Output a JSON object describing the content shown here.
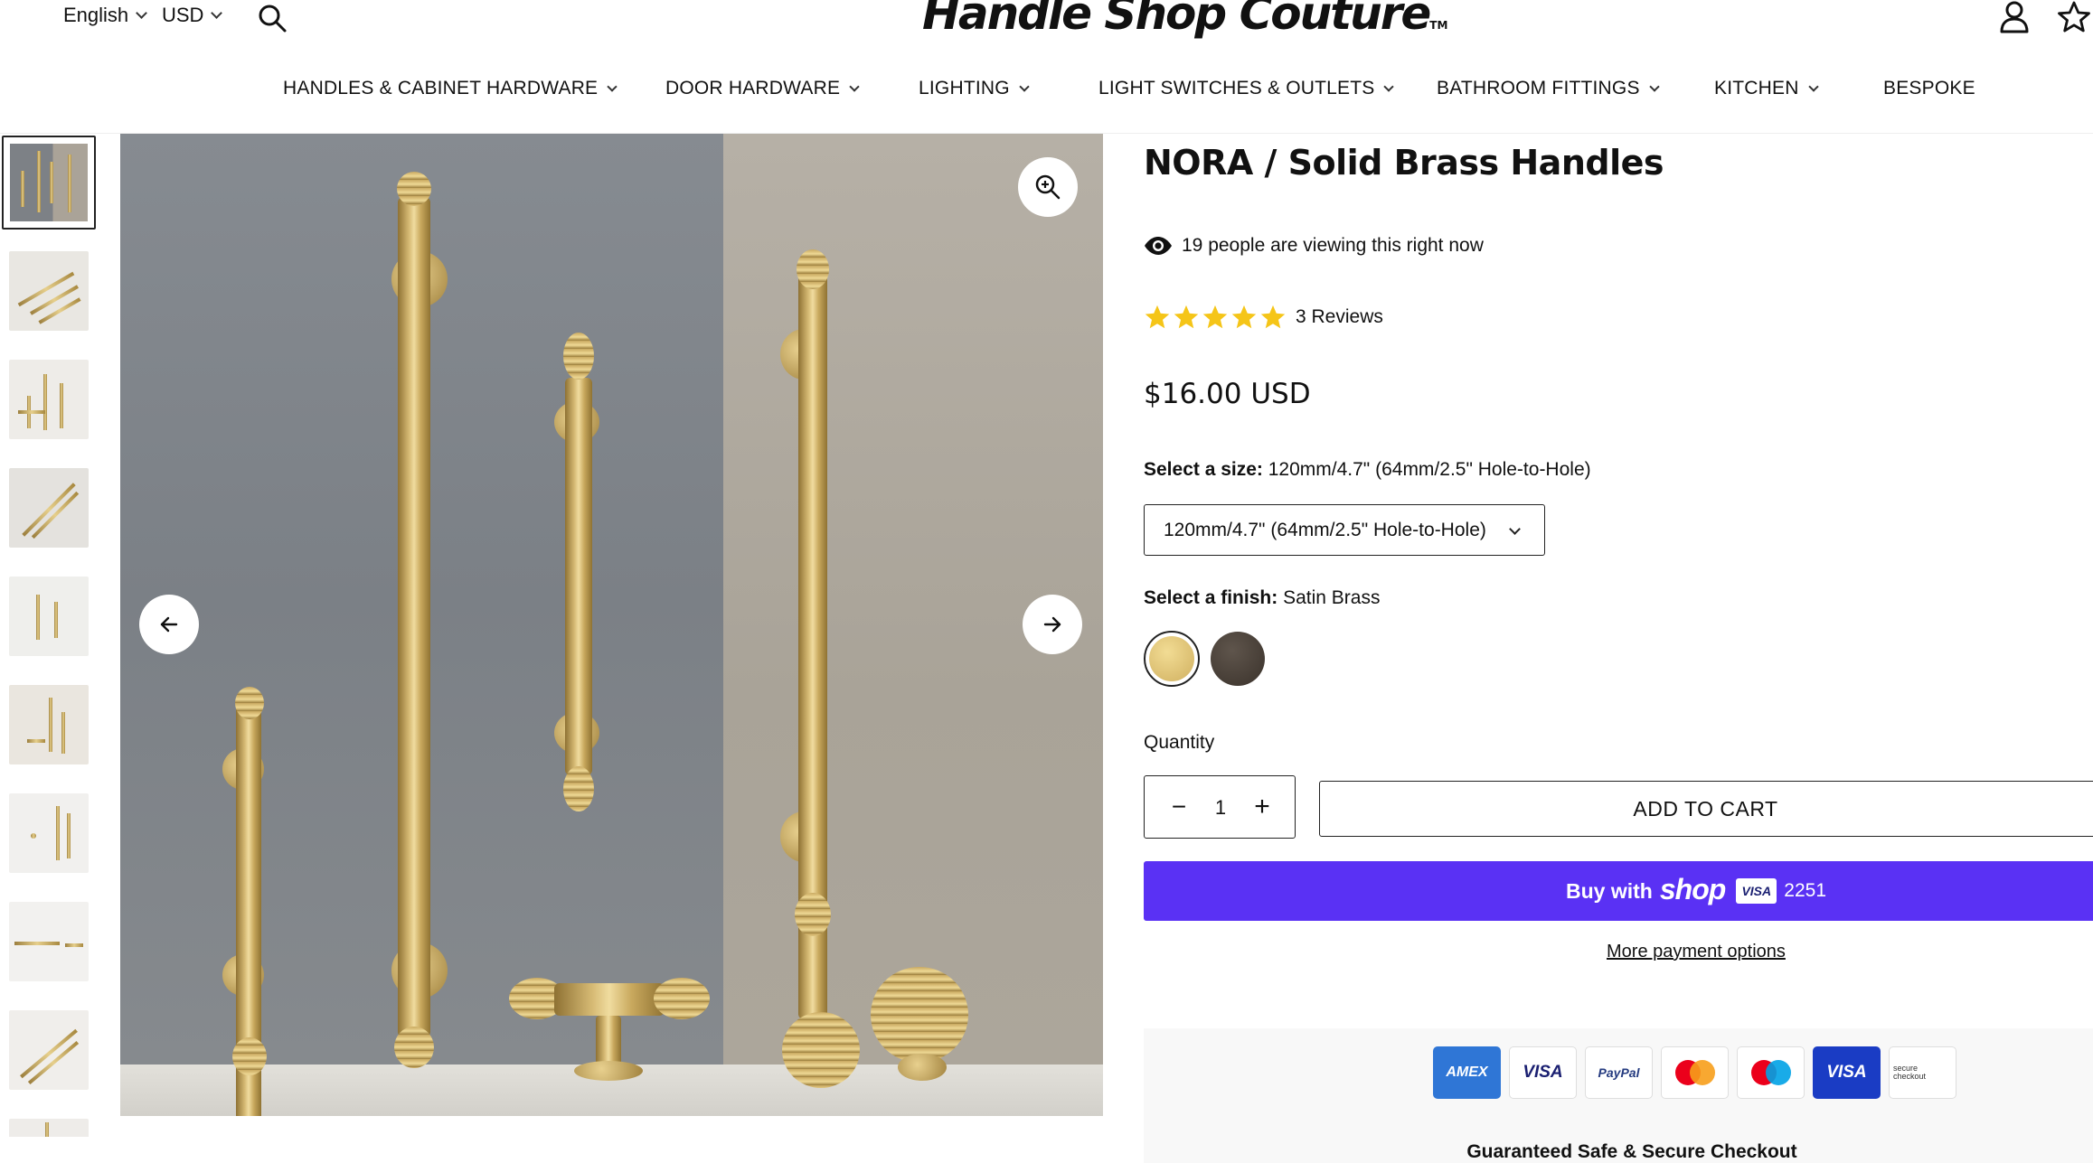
{
  "header": {
    "language": "English",
    "currency": "USD",
    "logo_text": "Handle Shop Couture",
    "logo_tm": "TM"
  },
  "nav": {
    "items": [
      {
        "label": "HANDLES & CABINET HARDWARE",
        "has_dropdown": true
      },
      {
        "label": "DOOR HARDWARE",
        "has_dropdown": true
      },
      {
        "label": "LIGHTING",
        "has_dropdown": true
      },
      {
        "label": "LIGHT SWITCHES & OUTLETS",
        "has_dropdown": true
      },
      {
        "label": "BATHROOM FITTINGS",
        "has_dropdown": true
      },
      {
        "label": "KITCHEN",
        "has_dropdown": true
      },
      {
        "label": "BESPOKE",
        "has_dropdown": false
      }
    ]
  },
  "gallery": {
    "thumbnail_count": 10,
    "active_index": 0
  },
  "product": {
    "title": "NORA / Solid Brass Handles",
    "viewing": "19 people are viewing this right now",
    "rating": 5,
    "reviews": "3 Reviews",
    "price": "$16.00 USD",
    "size_label": "Select a size:",
    "size_value": "120mm/4.7\" (64mm/2.5\" Hole-to-Hole)",
    "size_selected": "120mm/4.7\" (64mm/2.5\" Hole-to-Hole)",
    "finish_label": "Select a finish:",
    "finish_value": "Satin Brass",
    "quantity_label": "Quantity",
    "quantity": "1",
    "qty_minus": "−",
    "qty_plus": "+",
    "add_to_cart": "ADD TO CART",
    "buy_with": "Buy with",
    "shop_brand": "shop",
    "card_brand": "VISA",
    "card_last4": "2251",
    "more_payment": "More payment options"
  },
  "payment": {
    "cards": [
      "AMEX",
      "VISA",
      "PayPal",
      "mastercard",
      "maestro",
      "VISA",
      "secure checkout"
    ],
    "guarantee": "Guaranteed Safe & Secure Checkout"
  },
  "colors": {
    "shop_pay": "#5a31f4",
    "star": "#f5c518",
    "brass": "#d4b66b",
    "bronze": "#4a3f36"
  }
}
